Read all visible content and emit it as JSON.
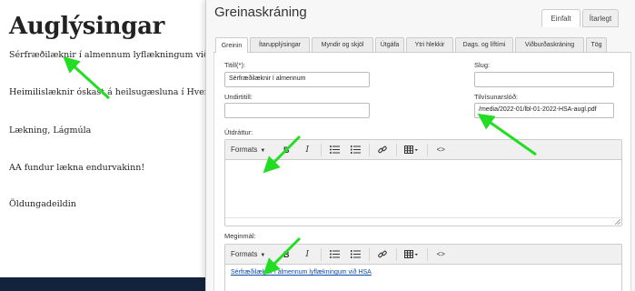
{
  "background_page": {
    "title": "Auglýsingar",
    "items": [
      "Sérfræðilæknir í almennum lyflækningum við HSA",
      "Heimilislæknir óskast á heilsugæsluna í Hveragerði o",
      "Lækning, Lágmúla",
      "AA fundur lækna endurvakinn!",
      "Öldungadeildin"
    ]
  },
  "modal": {
    "title": "Greinaskráning",
    "view_tabs": [
      "Einfalt",
      "Ítarlegt"
    ],
    "tabs": [
      "Greinin",
      "Ítarupplýsingar",
      "Myndir og skjöl",
      "Útgáfa",
      "Ytri hlekkir",
      "Dags. og líftími",
      "Viðburðaskráning",
      "Tög"
    ],
    "fields": {
      "title_label": "Titill(*):",
      "title_value": "Sérfræðilæknir í almennum",
      "subtitle_label": "Undirtitill:",
      "subtitle_value": "",
      "slug_label": "Slug:",
      "slug_value": "",
      "reference_label": "Tilvísunarslóð:",
      "reference_value": "/media/2022-01/lbl-01-2022-HSA-augl.pdf",
      "summary_label": "Útdráttur:",
      "body_label": "Meginmál:",
      "body_content": "Sérfræðilæknir í almennum lyflækningum við HSA"
    },
    "toolbar": {
      "formats_label": "Formats",
      "bold": "B",
      "italic": "I",
      "source": "<>"
    }
  },
  "colors": {
    "arrow": "#22dd22",
    "link": "#0b4aa6",
    "footer": "#14233d"
  }
}
